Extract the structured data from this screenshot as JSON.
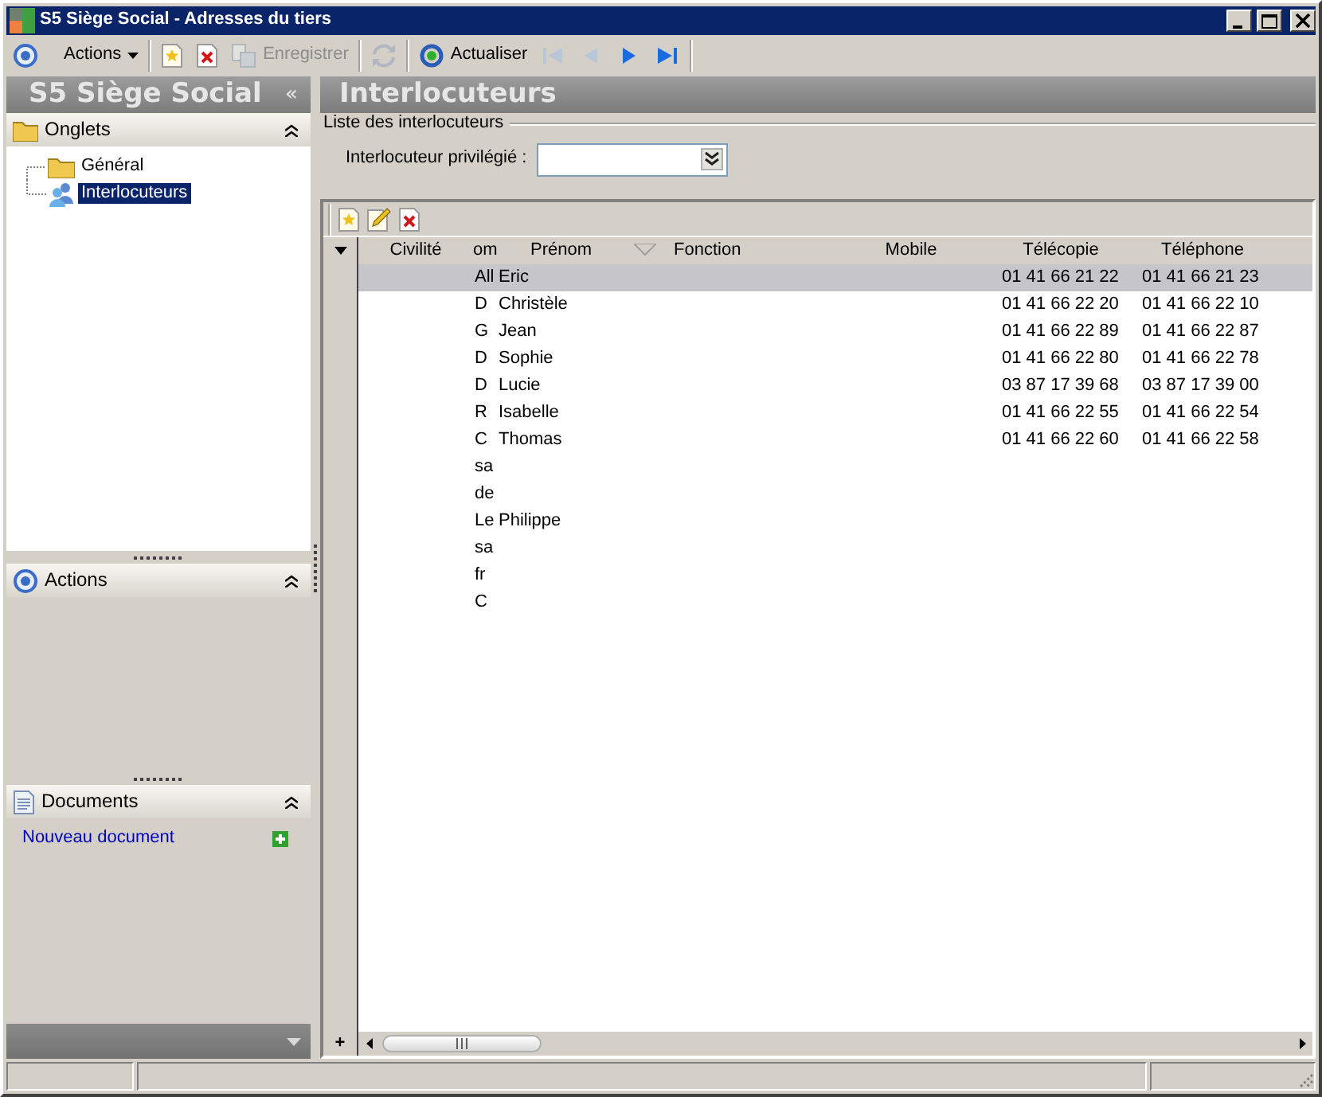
{
  "window": {
    "title": "S5 Siège Social -  Adresses du tiers"
  },
  "toolbar": [
    {
      "kind": "icon-button",
      "disabled": false
    },
    {
      "kind": "menu",
      "label": "Actions",
      "disabled": false
    },
    {
      "kind": "separator"
    },
    {
      "kind": "icon-button",
      "disabled": false
    },
    {
      "kind": "icon-button",
      "disabled": false
    },
    {
      "kind": "text-button",
      "label": "Enregistrer",
      "disabled": true
    },
    {
      "kind": "separator"
    },
    {
      "kind": "icon-button",
      "disabled": true
    },
    {
      "kind": "separator"
    },
    {
      "kind": "text-button",
      "label": "Actualiser",
      "disabled": false
    },
    {
      "kind": "icon-button",
      "disabled": true
    },
    {
      "kind": "icon-button",
      "disabled": true
    },
    {
      "kind": "icon-button",
      "disabled": false
    },
    {
      "kind": "icon-button",
      "disabled": false
    },
    {
      "kind": "separator"
    }
  ],
  "sidebar": {
    "title": "S5 Siège Social",
    "collapse": "«",
    "sections": [
      {
        "kind": "tree",
        "title": "Onglets",
        "items": [
          {
            "label": "Général",
            "selected": false
          },
          {
            "label": "Interlocuteurs",
            "selected": true
          }
        ]
      },
      {
        "kind": "actions",
        "title": "Actions"
      },
      {
        "kind": "documents",
        "title": "Documents",
        "link": "Nouveau document"
      }
    ]
  },
  "content": {
    "title": "Interlocuteurs",
    "group": "Liste des interlocuteurs",
    "field": {
      "label": "Interlocuteur privilégié :"
    },
    "table": {
      "columns": [
        {
          "label": "Civilité",
          "sorted": false
        },
        {
          "label": "om",
          "sorted": false
        },
        {
          "label": "Prénom",
          "sorted": true
        },
        {
          "label": "Fonction",
          "sorted": false
        },
        {
          "label": "Mobile",
          "sorted": false
        },
        {
          "label": "Télécopie",
          "sorted": false
        },
        {
          "label": "Téléphone",
          "sorted": false
        }
      ],
      "rows": [
        {
          "nom": "All",
          "prenom": "Eric",
          "telecopie": "01 41 66 21 22",
          "telephone": "01 41 66 21 23",
          "selected": true
        },
        {
          "nom": "D",
          "prenom": "Christèle",
          "telecopie": "01 41 66 22 20",
          "telephone": "01 41 66 22 10",
          "selected": false
        },
        {
          "nom": "G",
          "prenom": "Jean",
          "telecopie": "01 41 66 22 89",
          "telephone": "01 41 66 22 87",
          "selected": false
        },
        {
          "nom": "D",
          "prenom": "Sophie",
          "telecopie": "01 41 66 22 80",
          "telephone": "01 41 66 22 78",
          "selected": false
        },
        {
          "nom": "D",
          "prenom": "Lucie",
          "telecopie": "03 87 17 39 68",
          "telephone": "03 87 17 39 00",
          "selected": false
        },
        {
          "nom": "R",
          "prenom": "Isabelle",
          "telecopie": "01 41 66 22 55",
          "telephone": "01 41 66 22 54",
          "selected": false
        },
        {
          "nom": "C",
          "prenom": "Thomas",
          "telecopie": "01 41 66 22 60",
          "telephone": "01 41 66 22 58",
          "selected": false
        },
        {
          "nom": "sa",
          "selected": false
        },
        {
          "nom": "de",
          "selected": false
        },
        {
          "nom": "Le",
          "prenom": "Philippe",
          "selected": false
        },
        {
          "nom": "sa",
          "selected": false
        },
        {
          "nom": "fr",
          "selected": false
        },
        {
          "nom": "C",
          "selected": false
        }
      ],
      "add": "+"
    }
  }
}
